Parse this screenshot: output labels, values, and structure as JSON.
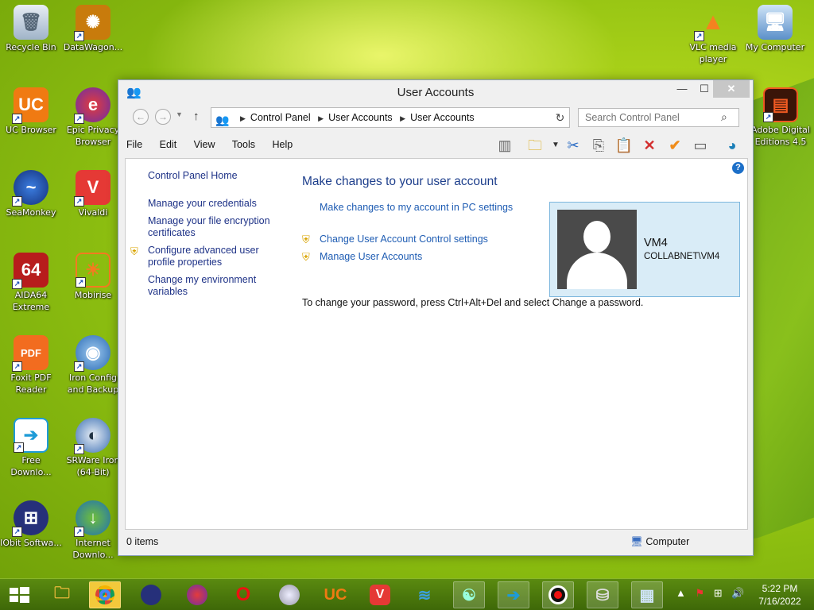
{
  "desktop": {
    "icons": [
      {
        "label": "Recycle Bin"
      },
      {
        "label": "DataWagon..."
      },
      {
        "label": "UC Browser"
      },
      {
        "label": "Epic Privacy Browser"
      },
      {
        "label": "SeaMonkey"
      },
      {
        "label": "Vivaldi"
      },
      {
        "label": "AIDA64 Extreme"
      },
      {
        "label": "Mobirise"
      },
      {
        "label": "Foxit PDF Reader"
      },
      {
        "label": "Iron Config and Backup"
      },
      {
        "label": "Free Downlo..."
      },
      {
        "label": "SRWare Iron (64-Bit)"
      },
      {
        "label": "IObit Softwa..."
      },
      {
        "label": "Internet Downlo..."
      },
      {
        "label": "VLC media player"
      },
      {
        "label": "My Computer"
      },
      {
        "label": "Adobe Digital Editions 4.5"
      }
    ]
  },
  "window": {
    "title": "User Accounts",
    "address": {
      "crumbs": [
        "Control Panel",
        "User Accounts",
        "User Accounts"
      ]
    },
    "search": {
      "placeholder": "Search Control Panel"
    },
    "menu": [
      "File",
      "Edit",
      "View",
      "Tools",
      "Help"
    ],
    "leftnav": {
      "home": "Control Panel Home",
      "items": [
        "Manage your credentials",
        "Manage your file encryption certificates",
        "Configure advanced user profile properties",
        "Change my environment variables"
      ]
    },
    "main": {
      "heading": "Make changes to your user account",
      "pc_settings_link": "Make changes to my account in PC settings",
      "uac_link": "Change User Account Control settings",
      "manage_link": "Manage User Accounts",
      "password_note": "To change your password, press Ctrl+Alt+Del and select Change a password."
    },
    "user": {
      "name": "VM4",
      "domain": "COLLABNET\\VM4"
    },
    "status": {
      "items": "0 items",
      "location": "Computer"
    }
  },
  "taskbar": {
    "clock_time": "5:22 PM",
    "clock_date": "7/16/2022"
  }
}
